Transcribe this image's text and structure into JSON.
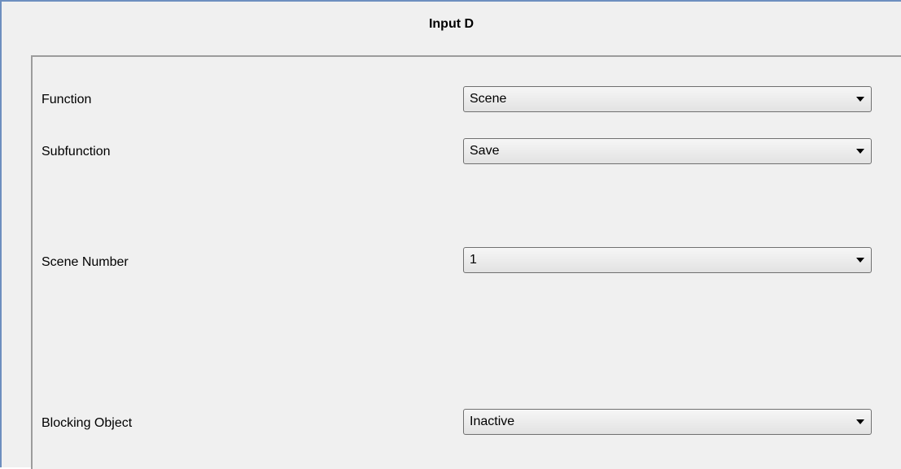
{
  "window": {
    "title": "Input D"
  },
  "params": [
    {
      "label": "Function",
      "value": "Scene"
    },
    {
      "label": "Subfunction",
      "value": "Save"
    },
    {
      "label": "Scene Number",
      "value": "1"
    },
    {
      "label": "Blocking Object",
      "value": "Inactive"
    }
  ]
}
